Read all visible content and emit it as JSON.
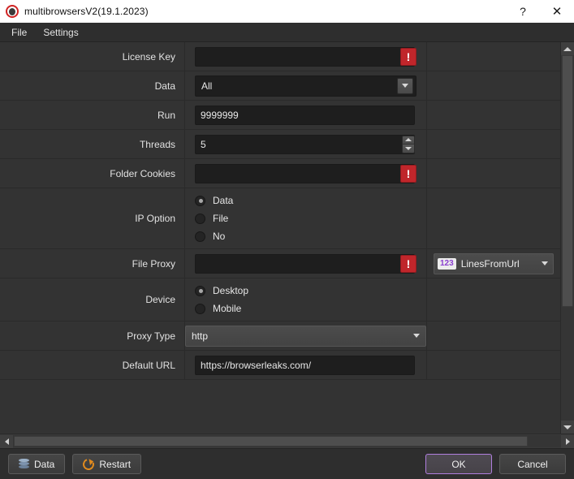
{
  "window": {
    "title": "multibrowsersV2(19.1.2023)",
    "app_icon": "app-logo-icon",
    "help_label": "?",
    "close_label": "✕"
  },
  "menubar": {
    "items": [
      {
        "label": "File"
      },
      {
        "label": "Settings"
      }
    ]
  },
  "form": {
    "rows": [
      {
        "label": "License Key",
        "type": "text_error",
        "value": "",
        "error": "!"
      },
      {
        "label": "Data",
        "type": "combo_dark",
        "value": "All"
      },
      {
        "label": "Run",
        "type": "text",
        "value": "9999999"
      },
      {
        "label": "Threads",
        "type": "spinner",
        "value": "5"
      },
      {
        "label": "Folder Cookies",
        "type": "text_error",
        "value": "",
        "error": "!"
      },
      {
        "label": "IP Option",
        "type": "radio",
        "options": [
          {
            "label": "Data",
            "selected": true
          },
          {
            "label": "File",
            "selected": false
          },
          {
            "label": "No",
            "selected": false
          }
        ]
      },
      {
        "label": "File Proxy",
        "type": "text_error_extra",
        "value": "",
        "error": "!",
        "extra": {
          "badge": "123",
          "value": "LinesFromUrl"
        }
      },
      {
        "label": "Device",
        "type": "radio",
        "options": [
          {
            "label": "Desktop",
            "selected": true
          },
          {
            "label": "Mobile",
            "selected": false
          }
        ]
      },
      {
        "label": "Proxy Type",
        "type": "combo_flat",
        "value": "http"
      },
      {
        "label": "Default URL",
        "type": "text",
        "value": "https://browserleaks.com/"
      }
    ]
  },
  "bottom": {
    "data_label": "Data",
    "restart_label": "Restart",
    "ok_label": "OK",
    "cancel_label": "Cancel"
  },
  "colors": {
    "accent_focus": "#b07ede",
    "error_red": "#c0262b",
    "badge_purple": "#8b3fd0",
    "restart_orange": "#e08a1e",
    "panel_bg": "#333333"
  }
}
